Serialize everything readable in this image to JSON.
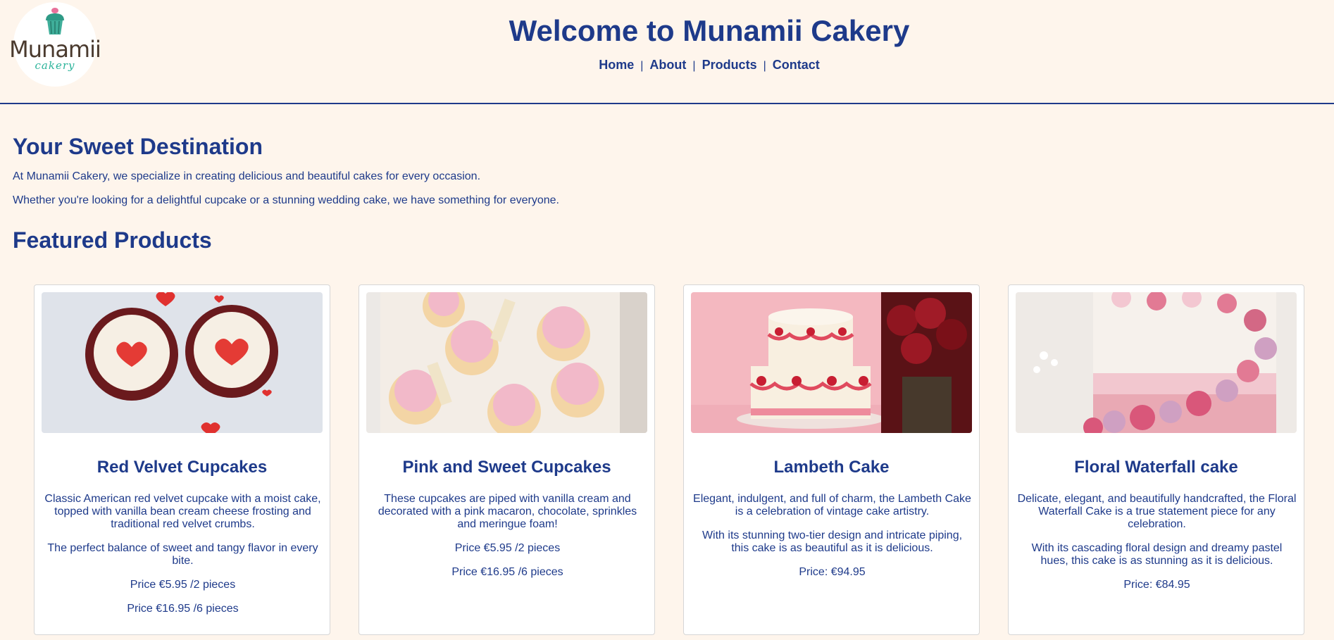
{
  "logo": {
    "brand": "Munamii",
    "sub": "cakery",
    "icon": "cupcake-icon"
  },
  "header": {
    "title": "Welcome to Munamii Cakery",
    "nav": [
      {
        "label": "Home"
      },
      {
        "label": "About"
      },
      {
        "label": "Products"
      },
      {
        "label": "Contact"
      }
    ],
    "separator": "|"
  },
  "intro": {
    "heading": "Your Sweet Destination",
    "paragraphs": [
      "At Munamii Cakery, we specialize in creating delicious and beautiful cakes for every occasion.",
      "Whether you're looking for a delightful cupcake or a stunning wedding cake, we have something for everyone."
    ]
  },
  "featured": {
    "heading": "Featured Products",
    "products": [
      {
        "name": "Red Velvet Cupcakes",
        "lines": [
          "Classic American red velvet cupcake with a moist cake, topped with vanilla bean cream cheese frosting and traditional red velvet crumbs.",
          "The perfect balance of sweet and tangy flavor in every bite.",
          "Price €5.95 /2 pieces",
          "Price €16.95 /6 pieces"
        ]
      },
      {
        "name": "Pink and Sweet Cupcakes",
        "lines": [
          "These cupcakes are piped with vanilla cream and decorated with a pink macaron, chocolate, sprinkles and meringue foam!",
          "Price €5.95 /2 pieces",
          "Price €16.95 /6 pieces"
        ]
      },
      {
        "name": "Lambeth Cake",
        "lines": [
          "Elegant, indulgent, and full of charm, the Lambeth Cake is a celebration of vintage cake artistry.",
          "With its stunning two-tier design and intricate piping, this cake is as beautiful as it is delicious.",
          "Price: €94.95"
        ]
      },
      {
        "name": "Floral Waterfall cake",
        "lines": [
          "Delicate, elegant, and beautifully handcrafted, the Floral Waterfall Cake is a true statement piece for any celebration.",
          "With its cascading floral design and dreamy pastel hues, this cake is as stunning as it is delicious.",
          "Price: €84.95"
        ]
      }
    ]
  },
  "colors": {
    "accent": "#1e3a8a",
    "background": "#fef5ec",
    "card": "#ffffff"
  }
}
